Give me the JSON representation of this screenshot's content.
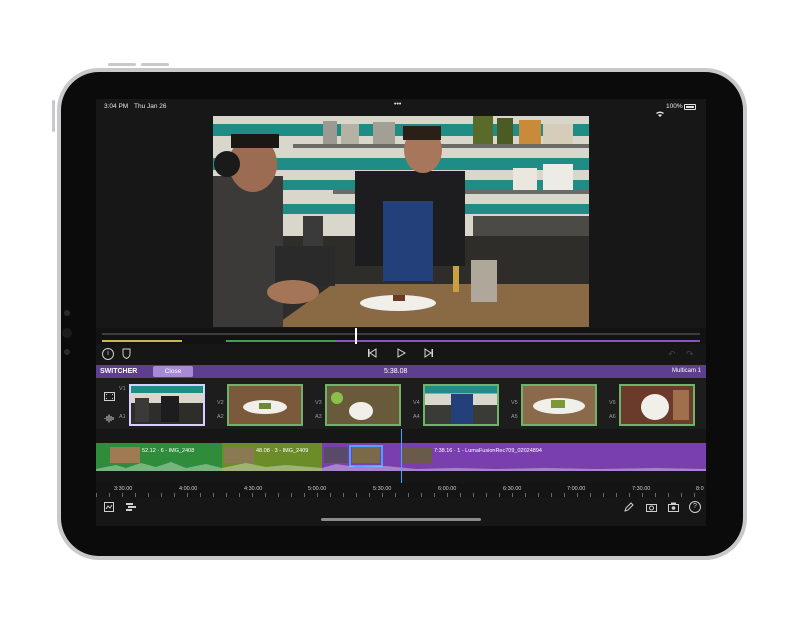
{
  "status_bar": {
    "time": "3:04 PM",
    "date": "Thu Jan 26",
    "battery": "100%",
    "dots": "•••"
  },
  "switcher": {
    "title": "SWITCHER",
    "close_label": "Close",
    "timecode": "5:38.08",
    "multicam_label": "Multicam 1"
  },
  "angles": [
    {
      "video": "V1",
      "audio": "A1"
    },
    {
      "video": "V2",
      "audio": "A2"
    },
    {
      "video": "V3",
      "audio": "A3"
    },
    {
      "video": "V4",
      "audio": "A4"
    },
    {
      "video": "V5",
      "audio": "A5"
    },
    {
      "video": "V6",
      "audio": "A6"
    }
  ],
  "timeline": {
    "clips": [
      {
        "label": "52.12 · 6 - IMG_2408"
      },
      {
        "label": "48.08 · 3 - IMG_2409"
      },
      {
        "label": "7:38.16 · 1 - LumaFusionRec709_02024894"
      }
    ],
    "ruler": [
      "3:30.00",
      "4:00.00",
      "4:30.00",
      "5:00.00",
      "5:30.00",
      "6:00.00",
      "6:30.00",
      "7:00.00",
      "7:30.00",
      "8:0"
    ]
  },
  "colors": {
    "switcher_bar": "#5e3e8e",
    "close_button": "#a78ad6",
    "clip_green": "#2f8c3a",
    "clip_purple": "#7a3fae",
    "angle_border": "#6fb36a"
  },
  "icons": {
    "info": "info-icon",
    "shield": "shield-icon",
    "skip_back": "skip-back-icon",
    "play": "play-icon",
    "skip_forward": "skip-forward-icon",
    "undo": "undo-icon",
    "redo": "redo-icon",
    "film": "film-icon",
    "audio": "audio-waveform-icon",
    "library": "media-library-icon",
    "tracks": "tracks-icon",
    "pencil": "pencil-icon",
    "snapshot": "snapshot-icon",
    "camera": "camera-icon",
    "help": "help-icon",
    "wifi": "wifi-icon",
    "battery": "battery-icon"
  }
}
